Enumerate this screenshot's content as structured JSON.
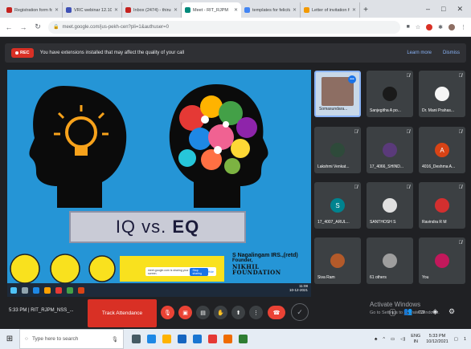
{
  "browser": {
    "tabs": [
      {
        "label": "Registration form for",
        "color": "#c5221f",
        "active": false
      },
      {
        "label": "VRC webinar 12.10.20",
        "color": "#3f51b5",
        "active": false
      },
      {
        "label": "Inbox (2474) - thirum",
        "color": "#c5221f",
        "active": false
      },
      {
        "label": "Meet - RIT_RJPM",
        "color": "#00897b",
        "active": true
      },
      {
        "label": "templates for felicitat",
        "color": "#4285f4",
        "active": false
      },
      {
        "label": "Letter of invitation fo",
        "color": "#f29900",
        "active": false
      }
    ],
    "new_tab": "+",
    "win_controls": {
      "minimize": "–",
      "maximize": "□",
      "close": "✕"
    },
    "url": "meet.google.com/jus-pekh-cen?pli=1&authuser=0"
  },
  "banner": {
    "rec_label": "REC",
    "text": "You have extensions installed that may affect the quality of your call",
    "learn_more": "Learn more",
    "dismiss": "Dismiss"
  },
  "slide": {
    "iq": "IQ vs.",
    "eq": "EQ",
    "founder_name": "S Nagalingam IRS.,(retd)",
    "founder_title": "Founder,",
    "founder_org": "NIKHIL FOUNDATION",
    "share_notice": "meet.google.com is sharing your screen.",
    "stop_sharing": "Stop sharing",
    "hide": "Hide",
    "inner_clock_time": "11:08",
    "inner_clock_date": "10-12-2021"
  },
  "participants": [
    {
      "name": "Somasundara...",
      "initial": "",
      "color": "#c8d8e8",
      "state": "speaking"
    },
    {
      "name": "Sanjegitha A po...",
      "initial": "",
      "color": "#1a1a1a",
      "state": "muted"
    },
    {
      "name": "Dr. Mani Prahas...",
      "initial": "",
      "color": "#f5f5f5",
      "state": "muted"
    },
    {
      "name": "Lakshmi Venkat...",
      "initial": "",
      "color": "#2e4a3a",
      "state": "muted"
    },
    {
      "name": "17_4066_SHIND...",
      "initial": "",
      "color": "#5a3a7a",
      "state": "muted"
    },
    {
      "name": "4016_Deshma A...",
      "initial": "A",
      "color": "#d84315",
      "state": "muted"
    },
    {
      "name": "17_4007_ARUL...",
      "initial": "S",
      "color": "#00838f",
      "state": "muted"
    },
    {
      "name": "SANTHOSH S",
      "initial": "",
      "color": "#e0e0e0",
      "state": "muted"
    },
    {
      "name": "Ravindra R M",
      "initial": "",
      "color": "#d32f2f",
      "state": "muted"
    },
    {
      "name": "Siva Ram",
      "initial": "",
      "color": "#b35a2a",
      "state": "none"
    },
    {
      "name": "61 others",
      "initial": "",
      "color": "#9e9e9e",
      "state": "none"
    },
    {
      "name": "You",
      "initial": "",
      "color": "#c2185b",
      "state": "muted"
    }
  ],
  "controls": {
    "meeting_info": "5:33 PM  |  RIT_RJPM_NSS_...",
    "track_attendance": "Track Attendance"
  },
  "watermark": {
    "line1": "Activate Windows",
    "line2": "Go to Settings to activate Windows."
  },
  "taskbar": {
    "search_placeholder": "Type here to search",
    "lang_line1": "ENG",
    "lang_line2": "IN",
    "time": "5:33 PM",
    "date": "10/12/2021",
    "notification_count": "1"
  }
}
